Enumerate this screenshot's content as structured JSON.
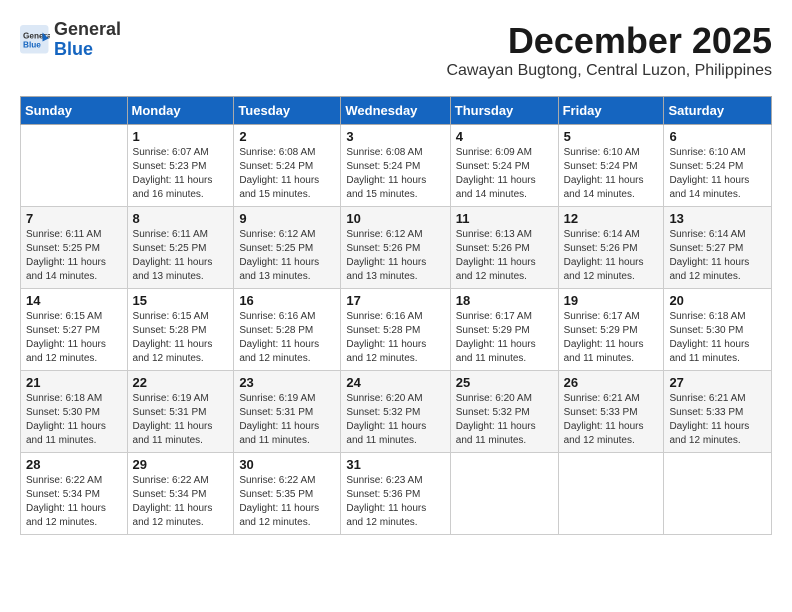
{
  "header": {
    "logo_line1": "General",
    "logo_line2": "Blue",
    "month_title": "December 2025",
    "location": "Cawayan Bugtong, Central Luzon, Philippines"
  },
  "days_of_week": [
    "Sunday",
    "Monday",
    "Tuesday",
    "Wednesday",
    "Thursday",
    "Friday",
    "Saturday"
  ],
  "weeks": [
    [
      {
        "day": "",
        "info": ""
      },
      {
        "day": "1",
        "info": "Sunrise: 6:07 AM\nSunset: 5:23 PM\nDaylight: 11 hours\nand 16 minutes."
      },
      {
        "day": "2",
        "info": "Sunrise: 6:08 AM\nSunset: 5:24 PM\nDaylight: 11 hours\nand 15 minutes."
      },
      {
        "day": "3",
        "info": "Sunrise: 6:08 AM\nSunset: 5:24 PM\nDaylight: 11 hours\nand 15 minutes."
      },
      {
        "day": "4",
        "info": "Sunrise: 6:09 AM\nSunset: 5:24 PM\nDaylight: 11 hours\nand 14 minutes."
      },
      {
        "day": "5",
        "info": "Sunrise: 6:10 AM\nSunset: 5:24 PM\nDaylight: 11 hours\nand 14 minutes."
      },
      {
        "day": "6",
        "info": "Sunrise: 6:10 AM\nSunset: 5:24 PM\nDaylight: 11 hours\nand 14 minutes."
      }
    ],
    [
      {
        "day": "7",
        "info": "Sunrise: 6:11 AM\nSunset: 5:25 PM\nDaylight: 11 hours\nand 14 minutes."
      },
      {
        "day": "8",
        "info": "Sunrise: 6:11 AM\nSunset: 5:25 PM\nDaylight: 11 hours\nand 13 minutes."
      },
      {
        "day": "9",
        "info": "Sunrise: 6:12 AM\nSunset: 5:25 PM\nDaylight: 11 hours\nand 13 minutes."
      },
      {
        "day": "10",
        "info": "Sunrise: 6:12 AM\nSunset: 5:26 PM\nDaylight: 11 hours\nand 13 minutes."
      },
      {
        "day": "11",
        "info": "Sunrise: 6:13 AM\nSunset: 5:26 PM\nDaylight: 11 hours\nand 12 minutes."
      },
      {
        "day": "12",
        "info": "Sunrise: 6:14 AM\nSunset: 5:26 PM\nDaylight: 11 hours\nand 12 minutes."
      },
      {
        "day": "13",
        "info": "Sunrise: 6:14 AM\nSunset: 5:27 PM\nDaylight: 11 hours\nand 12 minutes."
      }
    ],
    [
      {
        "day": "14",
        "info": "Sunrise: 6:15 AM\nSunset: 5:27 PM\nDaylight: 11 hours\nand 12 minutes."
      },
      {
        "day": "15",
        "info": "Sunrise: 6:15 AM\nSunset: 5:28 PM\nDaylight: 11 hours\nand 12 minutes."
      },
      {
        "day": "16",
        "info": "Sunrise: 6:16 AM\nSunset: 5:28 PM\nDaylight: 11 hours\nand 12 minutes."
      },
      {
        "day": "17",
        "info": "Sunrise: 6:16 AM\nSunset: 5:28 PM\nDaylight: 11 hours\nand 12 minutes."
      },
      {
        "day": "18",
        "info": "Sunrise: 6:17 AM\nSunset: 5:29 PM\nDaylight: 11 hours\nand 11 minutes."
      },
      {
        "day": "19",
        "info": "Sunrise: 6:17 AM\nSunset: 5:29 PM\nDaylight: 11 hours\nand 11 minutes."
      },
      {
        "day": "20",
        "info": "Sunrise: 6:18 AM\nSunset: 5:30 PM\nDaylight: 11 hours\nand 11 minutes."
      }
    ],
    [
      {
        "day": "21",
        "info": "Sunrise: 6:18 AM\nSunset: 5:30 PM\nDaylight: 11 hours\nand 11 minutes."
      },
      {
        "day": "22",
        "info": "Sunrise: 6:19 AM\nSunset: 5:31 PM\nDaylight: 11 hours\nand 11 minutes."
      },
      {
        "day": "23",
        "info": "Sunrise: 6:19 AM\nSunset: 5:31 PM\nDaylight: 11 hours\nand 11 minutes."
      },
      {
        "day": "24",
        "info": "Sunrise: 6:20 AM\nSunset: 5:32 PM\nDaylight: 11 hours\nand 11 minutes."
      },
      {
        "day": "25",
        "info": "Sunrise: 6:20 AM\nSunset: 5:32 PM\nDaylight: 11 hours\nand 11 minutes."
      },
      {
        "day": "26",
        "info": "Sunrise: 6:21 AM\nSunset: 5:33 PM\nDaylight: 11 hours\nand 12 minutes."
      },
      {
        "day": "27",
        "info": "Sunrise: 6:21 AM\nSunset: 5:33 PM\nDaylight: 11 hours\nand 12 minutes."
      }
    ],
    [
      {
        "day": "28",
        "info": "Sunrise: 6:22 AM\nSunset: 5:34 PM\nDaylight: 11 hours\nand 12 minutes."
      },
      {
        "day": "29",
        "info": "Sunrise: 6:22 AM\nSunset: 5:34 PM\nDaylight: 11 hours\nand 12 minutes."
      },
      {
        "day": "30",
        "info": "Sunrise: 6:22 AM\nSunset: 5:35 PM\nDaylight: 11 hours\nand 12 minutes."
      },
      {
        "day": "31",
        "info": "Sunrise: 6:23 AM\nSunset: 5:36 PM\nDaylight: 11 hours\nand 12 minutes."
      },
      {
        "day": "",
        "info": ""
      },
      {
        "day": "",
        "info": ""
      },
      {
        "day": "",
        "info": ""
      }
    ]
  ]
}
